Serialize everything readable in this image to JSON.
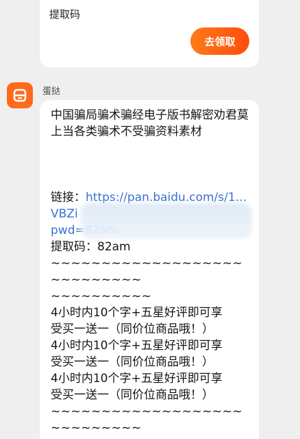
{
  "top_card": {
    "label": "提取码",
    "claim_button": "去领取"
  },
  "sender": {
    "name": "蛋挞"
  },
  "message": {
    "title": "中国骗局骗术骗经电子版书解密劝君莫上当各类骗术不受骗资料素材",
    "link_label": "链接：",
    "link_text": "https://pan.baidu.com/s/1…VBZi",
    "pwd": "pwd=82am",
    "code_line": "提取码：82am",
    "divider1a": "~~~~~~~~~~~~~~~~~~~~~~~~~~~~",
    "divider1b": "~~~~~~~~~~",
    "promo1a": "4小时内10个字+五星好评即可享",
    "promo1b": "受买一送一（同价位商品哦！）",
    "promo2a": "4小时内10个字+五星好评即可享",
    "promo2b": "受买一送一（同价位商品哦！）",
    "promo3a": "4小时内10个字+五星好评即可享",
    "promo3b": "受买一送一（同价位商品哦！）",
    "divider2a": "~~~~~~~~~~~~~~~~~~~~~~~~~~~~",
    "divider2b": "~~~~~~~~~~"
  },
  "colors": {
    "accent": "#ff5a12",
    "link": "#3a6fd0",
    "background": "#efefef"
  }
}
